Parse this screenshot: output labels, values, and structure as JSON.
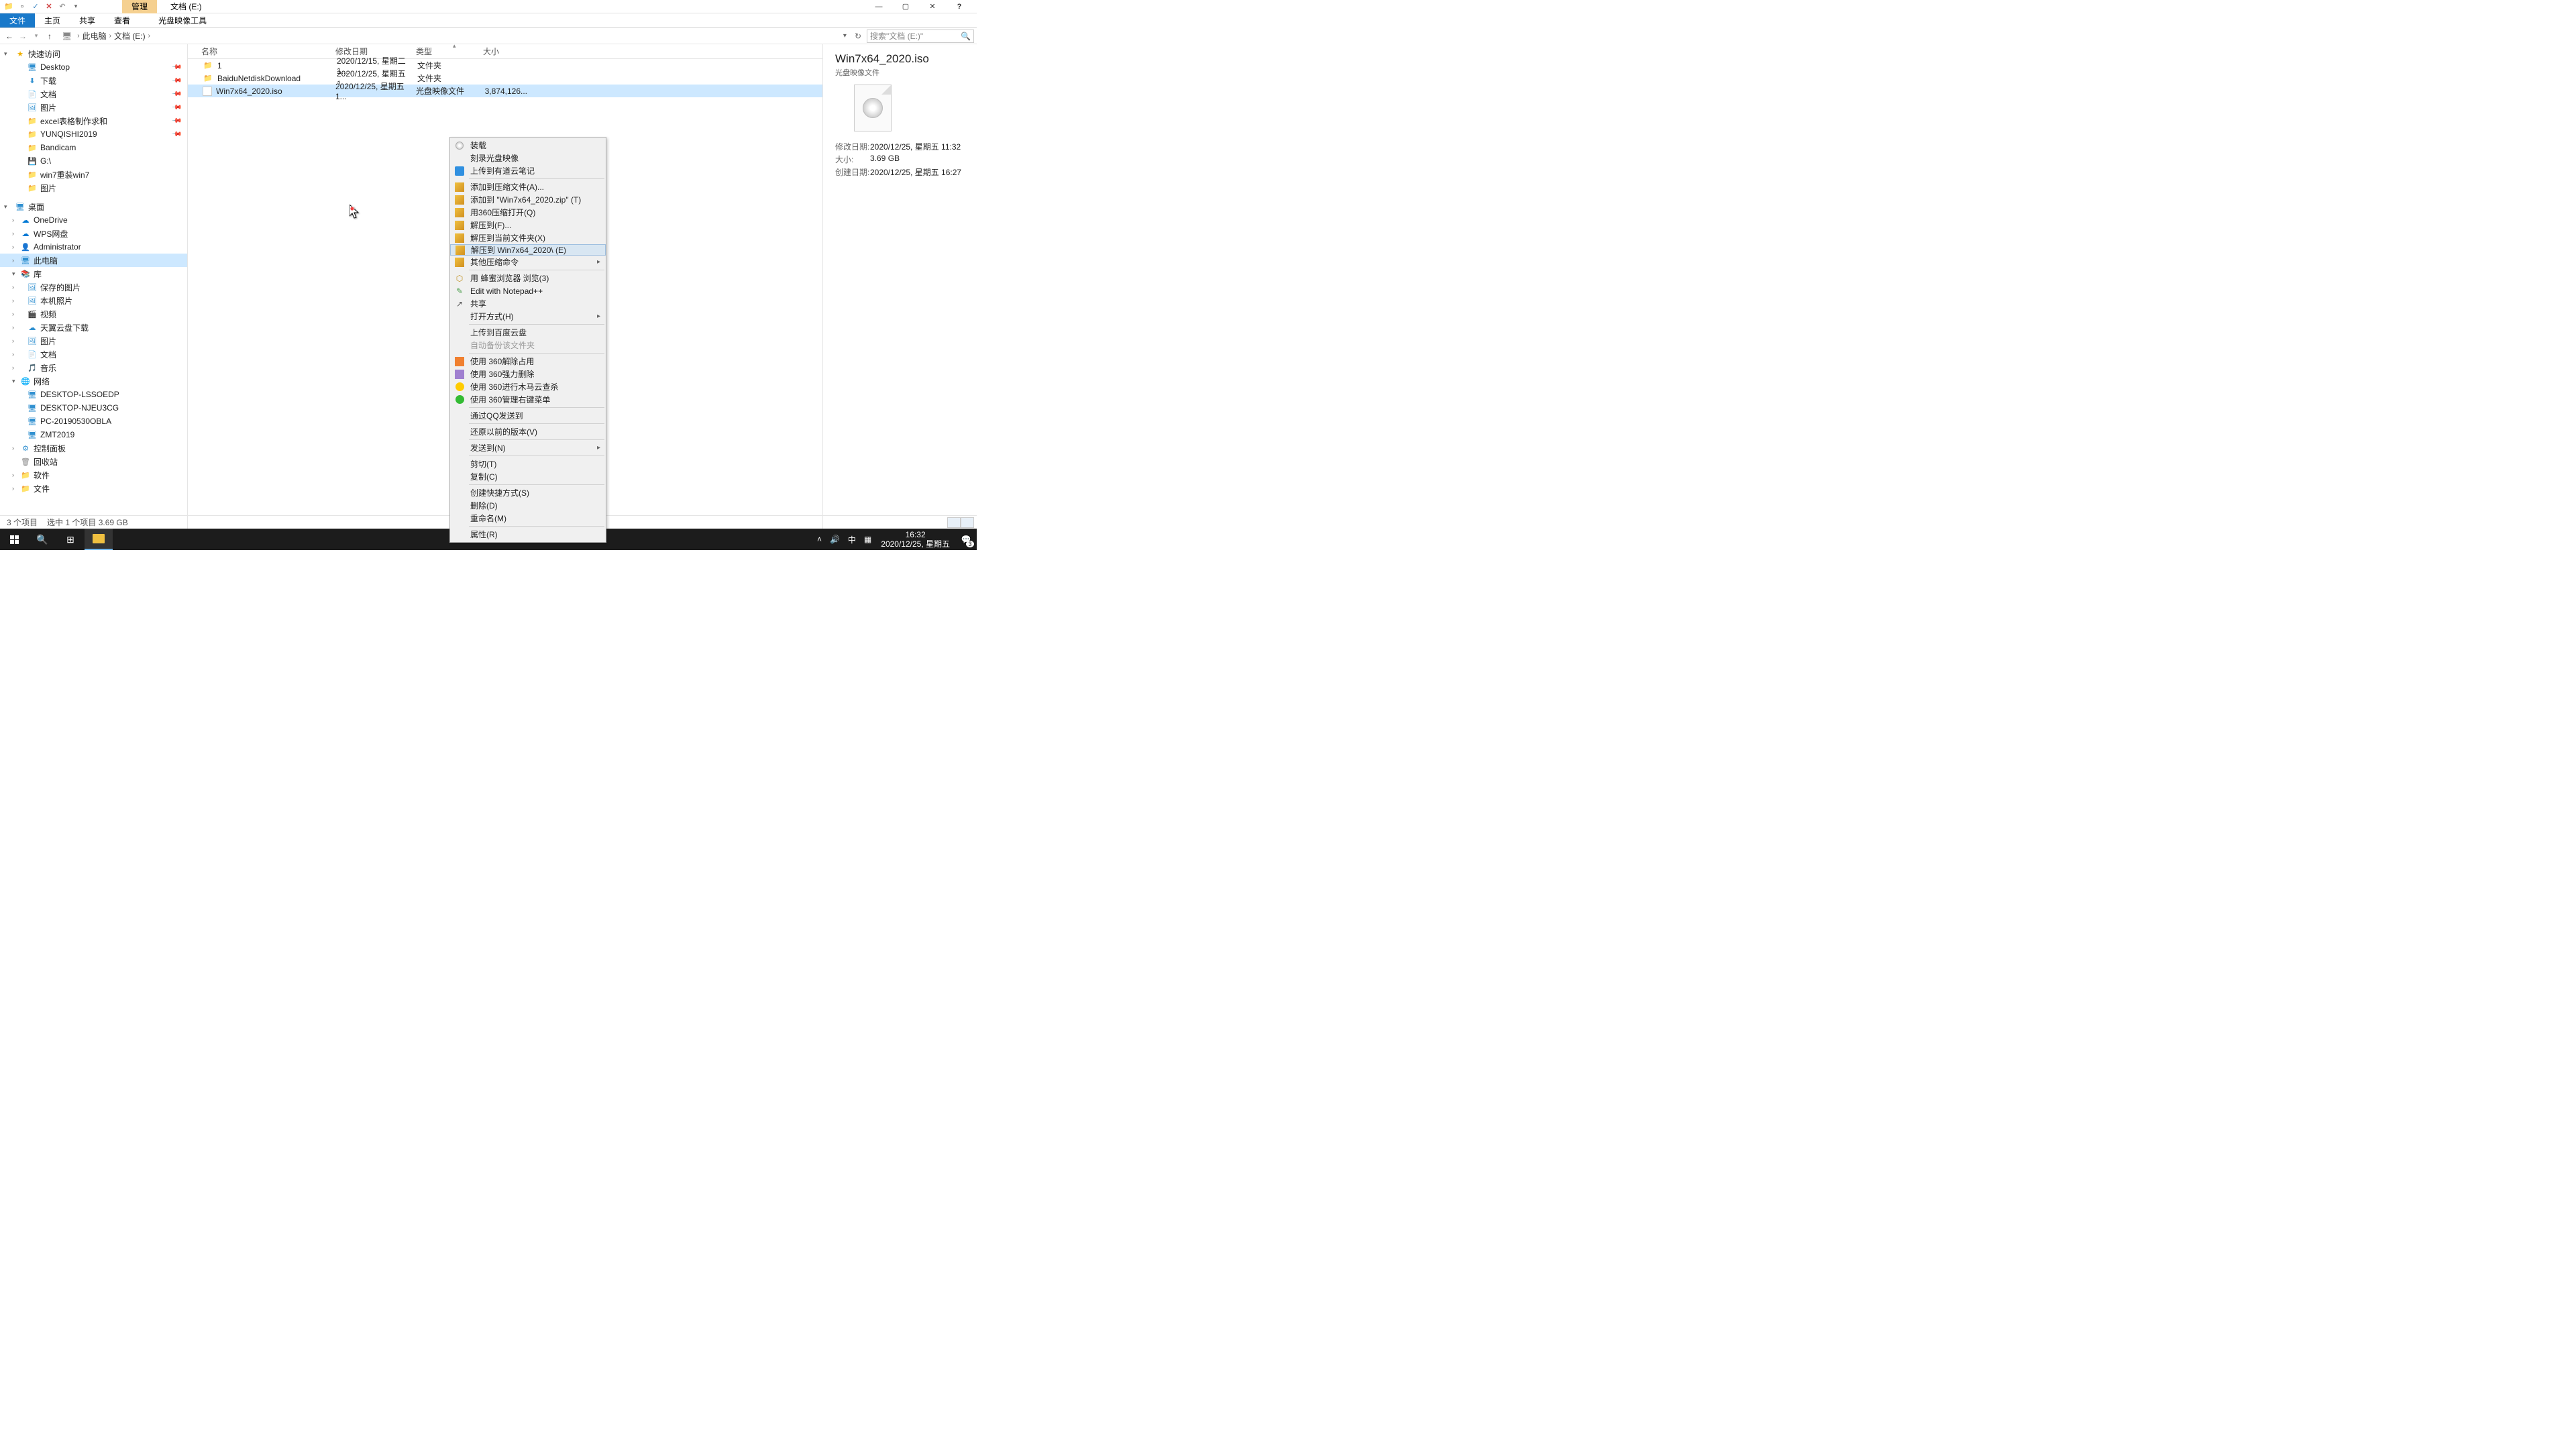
{
  "window": {
    "manage_tab": "管理",
    "title": "文档 (E:)",
    "ribbon": {
      "file": "文件",
      "home": "主页",
      "share": "共享",
      "view": "查看",
      "iso_tools": "光盘映像工具"
    },
    "controls": {
      "minimize": "—",
      "maximize": "▢",
      "close": "✕"
    }
  },
  "address": {
    "crumb1": "此电脑",
    "crumb2": "文档 (E:)",
    "search_placeholder": "搜索\"文档 (E:)\""
  },
  "tree": {
    "quick_access": "快速访问",
    "desktop": "Desktop",
    "downloads": "下载",
    "documents": "文档",
    "pictures": "图片",
    "excel": "excel表格制作求和",
    "yunqishi": "YUNQISHI2019",
    "bandicam": "Bandicam",
    "g_drive": "G:\\",
    "win7reinstall": "win7重装win7",
    "pictures2": "图片",
    "desktop_section": "桌面",
    "onedrive": "OneDrive",
    "wps": "WPS网盘",
    "admin": "Administrator",
    "this_pc": "此电脑",
    "libraries": "库",
    "saved_pics": "保存的图片",
    "local_photos": "本机照片",
    "videos": "视频",
    "tianyi": "天翼云盘下载",
    "pictures3": "图片",
    "documents2": "文档",
    "music": "音乐",
    "network": "网络",
    "pc1": "DESKTOP-LSSOEDP",
    "pc2": "DESKTOP-NJEU3CG",
    "pc3": "PC-20190530OBLA",
    "pc4": "ZMT2019",
    "control_panel": "控制面板",
    "recycle_bin": "回收站",
    "software": "软件",
    "files": "文件"
  },
  "list": {
    "headers": {
      "name": "名称",
      "date": "修改日期",
      "type": "类型",
      "size": "大小"
    },
    "rows": [
      {
        "name": "1",
        "date": "2020/12/15, 星期二 1...",
        "type": "文件夹",
        "size": ""
      },
      {
        "name": "BaiduNetdiskDownload",
        "date": "2020/12/25, 星期五 1...",
        "type": "文件夹",
        "size": ""
      },
      {
        "name": "Win7x64_2020.iso",
        "date": "2020/12/25, 星期五 1...",
        "type": "光盘映像文件",
        "size": "3,874,126..."
      }
    ]
  },
  "context_menu": [
    {
      "label": "装载",
      "icon": "disc"
    },
    {
      "label": "刻录光盘映像"
    },
    {
      "label": "上传到有道云笔记",
      "icon": "blue"
    },
    {
      "sep": true
    },
    {
      "label": "添加到压缩文件(A)...",
      "icon": "zip"
    },
    {
      "label": "添加到 \"Win7x64_2020.zip\" (T)",
      "icon": "zip"
    },
    {
      "label": "用360压缩打开(Q)",
      "icon": "zip"
    },
    {
      "label": "解压到(F)...",
      "icon": "zip"
    },
    {
      "label": "解压到当前文件夹(X)",
      "icon": "zip"
    },
    {
      "label": "解压到 Win7x64_2020\\ (E)",
      "icon": "zip",
      "highlighted": true
    },
    {
      "label": "其他压缩命令",
      "icon": "zip",
      "arrow": true
    },
    {
      "sep": true
    },
    {
      "label": "用 蜂蜜浏览器 浏览(3)",
      "icon": "hive"
    },
    {
      "label": "Edit with Notepad++",
      "icon": "npp"
    },
    {
      "label": "共享",
      "icon": "share"
    },
    {
      "label": "打开方式(H)",
      "arrow": true
    },
    {
      "sep": true
    },
    {
      "label": "上传到百度云盘"
    },
    {
      "label": "自动备份该文件夹",
      "disabled": true
    },
    {
      "sep": true
    },
    {
      "label": "使用 360解除占用",
      "icon": "orange"
    },
    {
      "label": "使用 360强力删除",
      "icon": "purple"
    },
    {
      "label": "使用 360进行木马云查杀",
      "icon": "yellow"
    },
    {
      "label": "使用 360管理右键菜单",
      "icon": "green"
    },
    {
      "sep": true
    },
    {
      "label": "通过QQ发送到"
    },
    {
      "sep": true
    },
    {
      "label": "还原以前的版本(V)"
    },
    {
      "sep": true
    },
    {
      "label": "发送到(N)",
      "arrow": true
    },
    {
      "sep": true
    },
    {
      "label": "剪切(T)"
    },
    {
      "label": "复制(C)"
    },
    {
      "sep": true
    },
    {
      "label": "创建快捷方式(S)"
    },
    {
      "label": "删除(D)"
    },
    {
      "label": "重命名(M)"
    },
    {
      "sep": true
    },
    {
      "label": "属性(R)"
    }
  ],
  "details": {
    "title": "Win7x64_2020.iso",
    "subtype": "光盘映像文件",
    "props": [
      {
        "label": "修改日期:",
        "value": "2020/12/25, 星期五 11:32"
      },
      {
        "label": "大小:",
        "value": "3.69 GB"
      },
      {
        "label": "创建日期:",
        "value": "2020/12/25, 星期五 16:27"
      }
    ]
  },
  "statusbar": {
    "items": "3 个项目",
    "selected": "选中 1 个项目  3.69 GB"
  },
  "taskbar": {
    "ime": "中",
    "time": "16:32",
    "date": "2020/12/25, 星期五",
    "notif_count": "3"
  }
}
